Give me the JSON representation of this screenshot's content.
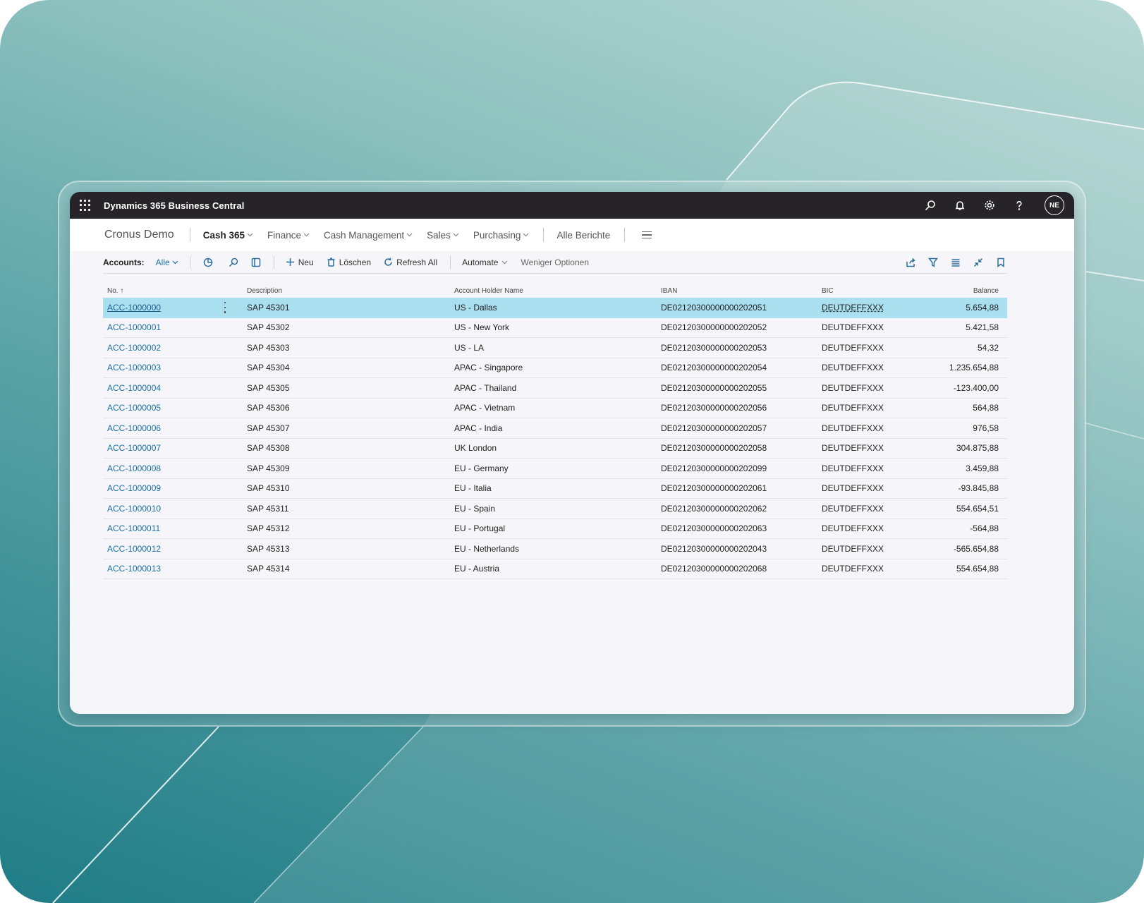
{
  "topbar": {
    "title": "Dynamics 365 Business Central",
    "avatar_initials": "NE"
  },
  "nav": {
    "company": "Cronus Demo",
    "items": [
      "Cash 365",
      "Finance",
      "Cash Management",
      "Sales",
      "Purchasing"
    ],
    "reports": "Alle Berichte"
  },
  "actionbar": {
    "label": "Accounts:",
    "filter": "Alle",
    "new": "Neu",
    "delete": "Löschen",
    "refresh": "Refresh All",
    "automate": "Automate",
    "fewer_options": "Weniger Optionen"
  },
  "table": {
    "headers": [
      "No. ↑",
      "Description",
      "Account Holder Name",
      "IBAN",
      "BIC",
      "Balance"
    ],
    "rows": [
      {
        "no": "ACC-1000000",
        "desc": "SAP 45301",
        "holder": "US - Dallas",
        "iban": "DE02120300000000202051",
        "bic": "DEUTDEFFXXX",
        "balance": "5.654,88"
      },
      {
        "no": "ACC-1000001",
        "desc": "SAP 45302",
        "holder": "US - New York",
        "iban": "DE02120300000000202052",
        "bic": "DEUTDEFFXXX",
        "balance": "5.421,58"
      },
      {
        "no": "ACC-1000002",
        "desc": "SAP 45303",
        "holder": "US - LA",
        "iban": "DE02120300000000202053",
        "bic": "DEUTDEFFXXX",
        "balance": "54,32"
      },
      {
        "no": "ACC-1000003",
        "desc": "SAP 45304",
        "holder": "APAC - Singapore",
        "iban": "DE02120300000000202054",
        "bic": "DEUTDEFFXXX",
        "balance": "1.235.654,88"
      },
      {
        "no": "ACC-1000004",
        "desc": "SAP 45305",
        "holder": "APAC - Thailand",
        "iban": "DE02120300000000202055",
        "bic": "DEUTDEFFXXX",
        "balance": "-123.400,00"
      },
      {
        "no": "ACC-1000005",
        "desc": "SAP 45306",
        "holder": "APAC - Vietnam",
        "iban": "DE02120300000000202056",
        "bic": "DEUTDEFFXXX",
        "balance": "564,88"
      },
      {
        "no": "ACC-1000006",
        "desc": "SAP 45307",
        "holder": "APAC - India",
        "iban": "DE02120300000000202057",
        "bic": "DEUTDEFFXXX",
        "balance": "976,58"
      },
      {
        "no": "ACC-1000007",
        "desc": "SAP 45308",
        "holder": "UK London",
        "iban": "DE02120300000000202058",
        "bic": "DEUTDEFFXXX",
        "balance": "304.875,88"
      },
      {
        "no": "ACC-1000008",
        "desc": "SAP 45309",
        "holder": "EU - Germany",
        "iban": "DE02120300000000202099",
        "bic": "DEUTDEFFXXX",
        "balance": "3.459,88"
      },
      {
        "no": "ACC-1000009",
        "desc": "SAP 45310",
        "holder": "EU - Italia",
        "iban": "DE02120300000000202061",
        "bic": "DEUTDEFFXXX",
        "balance": "-93.845,88"
      },
      {
        "no": "ACC-1000010",
        "desc": "SAP 45311",
        "holder": "EU - Spain",
        "iban": "DE02120300000000202062",
        "bic": "DEUTDEFFXXX",
        "balance": "554.654,51"
      },
      {
        "no": "ACC-1000011",
        "desc": "SAP 45312",
        "holder": "EU - Portugal",
        "iban": "DE02120300000000202063",
        "bic": "DEUTDEFFXXX",
        "balance": "-564,88"
      },
      {
        "no": "ACC-1000012",
        "desc": "SAP 45313",
        "holder": "EU - Netherlands",
        "iban": "DE02120300000000202043",
        "bic": "DEUTDEFFXXX",
        "balance": "-565.654,88"
      },
      {
        "no": "ACC-1000013",
        "desc": "SAP 45314",
        "holder": "EU - Austria",
        "iban": "DE02120300000000202068",
        "bic": "DEUTDEFFXXX",
        "balance": "554.654,88"
      }
    ]
  },
  "colors": {
    "topbar": "#262428",
    "link": "#1a6fa8",
    "selected_row": "#a9dfef",
    "teal_dark": "#1f7c86",
    "teal_light": "#b9d9d5"
  }
}
